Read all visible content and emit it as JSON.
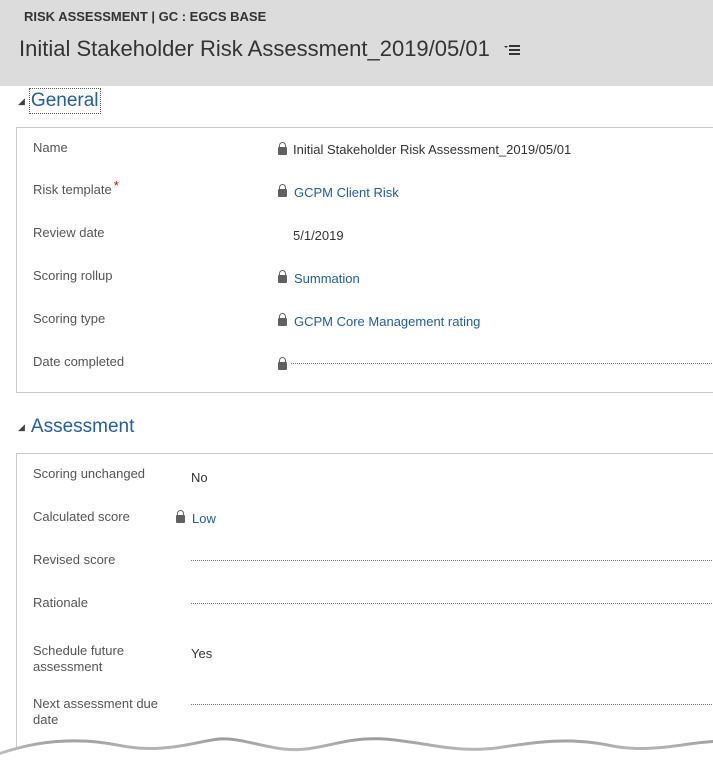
{
  "header": {
    "entity_type": "RISK ASSESSMENT | GC : EGCS BASE",
    "record_title": "Initial Stakeholder Risk Assessment_2019/05/01",
    "form_selector_icon": "list-menu-icon"
  },
  "general": {
    "title": "General",
    "fields": {
      "name": {
        "label": "Name",
        "value": "Initial Stakeholder Risk Assessment_2019/05/01"
      },
      "risk_template": {
        "label": "Risk template",
        "required_mark": "*",
        "value": "GCPM Client Risk"
      },
      "review_date": {
        "label": "Review date",
        "value": "5/1/2019"
      },
      "scoring_rollup": {
        "label": "Scoring rollup",
        "value": "Summation"
      },
      "scoring_type": {
        "label": "Scoring type",
        "value": "GCPM Core Management rating"
      },
      "date_completed": {
        "label": "Date completed",
        "value": ""
      }
    }
  },
  "assessment": {
    "title": "Assessment",
    "fields": {
      "scoring_unchanged": {
        "label": "Scoring unchanged",
        "value": "No"
      },
      "calculated_score": {
        "label": "Calculated score",
        "value": "Low"
      },
      "revised_score": {
        "label": "Revised score",
        "value": ""
      },
      "rationale": {
        "label": "Rationale",
        "value": ""
      },
      "schedule_future": {
        "label_line1": "Schedule future",
        "label_line2": "assessment",
        "value": "Yes"
      },
      "next_due": {
        "label_line1": "Next assessment due",
        "label_line2": "date",
        "value": ""
      }
    }
  },
  "colors": {
    "header_bg": "#dcdcdc",
    "link": "#1f5ea8",
    "required": "#cc0000"
  }
}
